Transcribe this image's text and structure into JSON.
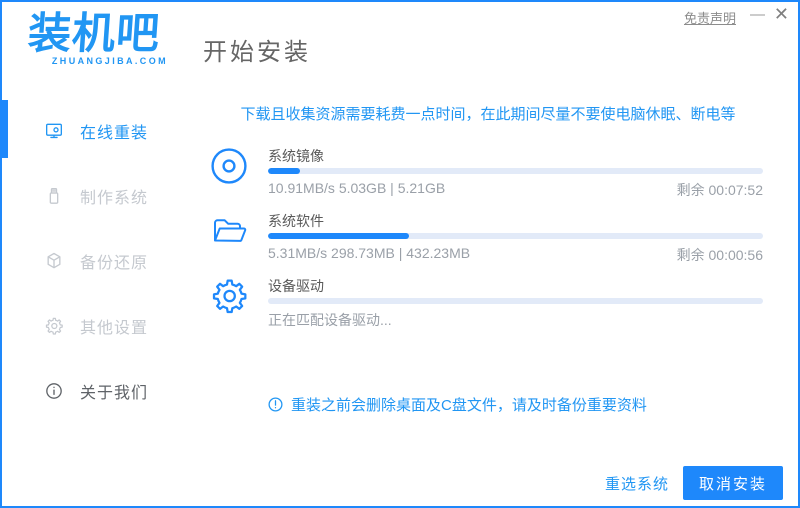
{
  "window": {
    "accent_color": "#1E88FB",
    "link_blue": "#2196F3",
    "track_color": "#E2EAF8"
  },
  "header": {
    "logo_text": "装机吧",
    "logo_sub": "ZHUANGJIBA.COM",
    "title": "开始安装",
    "disclaimer": "免责声明",
    "minimize_glyph": "—",
    "close_glyph": "✕"
  },
  "sidebar": {
    "items": [
      {
        "label": "在线重装",
        "icon": "monitor-icon",
        "active": true
      },
      {
        "label": "制作系统",
        "icon": "usb-icon",
        "active": false
      },
      {
        "label": "备份还原",
        "icon": "backup-box-icon",
        "active": false
      },
      {
        "label": "其他设置",
        "icon": "gear-icon",
        "active": false
      },
      {
        "label": "关于我们",
        "icon": "info-icon",
        "active": false
      }
    ]
  },
  "main": {
    "notice": "下载且收集资源需要耗费一点时间，在此期间尽量不要使电脑休眠、断电等",
    "sections": [
      {
        "title": "系统镜像",
        "icon": "disc-icon",
        "progress_percent": 6.5,
        "stats": "10.91MB/s 5.03GB | 5.21GB",
        "remaining": "剩余 00:07:52"
      },
      {
        "title": "系统软件",
        "icon": "folder-icon",
        "progress_percent": 28.5,
        "stats": "5.31MB/s 298.73MB | 432.23MB",
        "remaining": "剩余 00:00:56"
      },
      {
        "title": "设备驱动",
        "icon": "gear-icon",
        "progress_percent": 0,
        "stats": "正在匹配设备驱动...",
        "remaining": ""
      }
    ],
    "warning_note": "重装之前会删除桌面及C盘文件，请及时备份重要资料"
  },
  "footer": {
    "reselect_label": "重选系统",
    "cancel_label": "取消安装"
  }
}
